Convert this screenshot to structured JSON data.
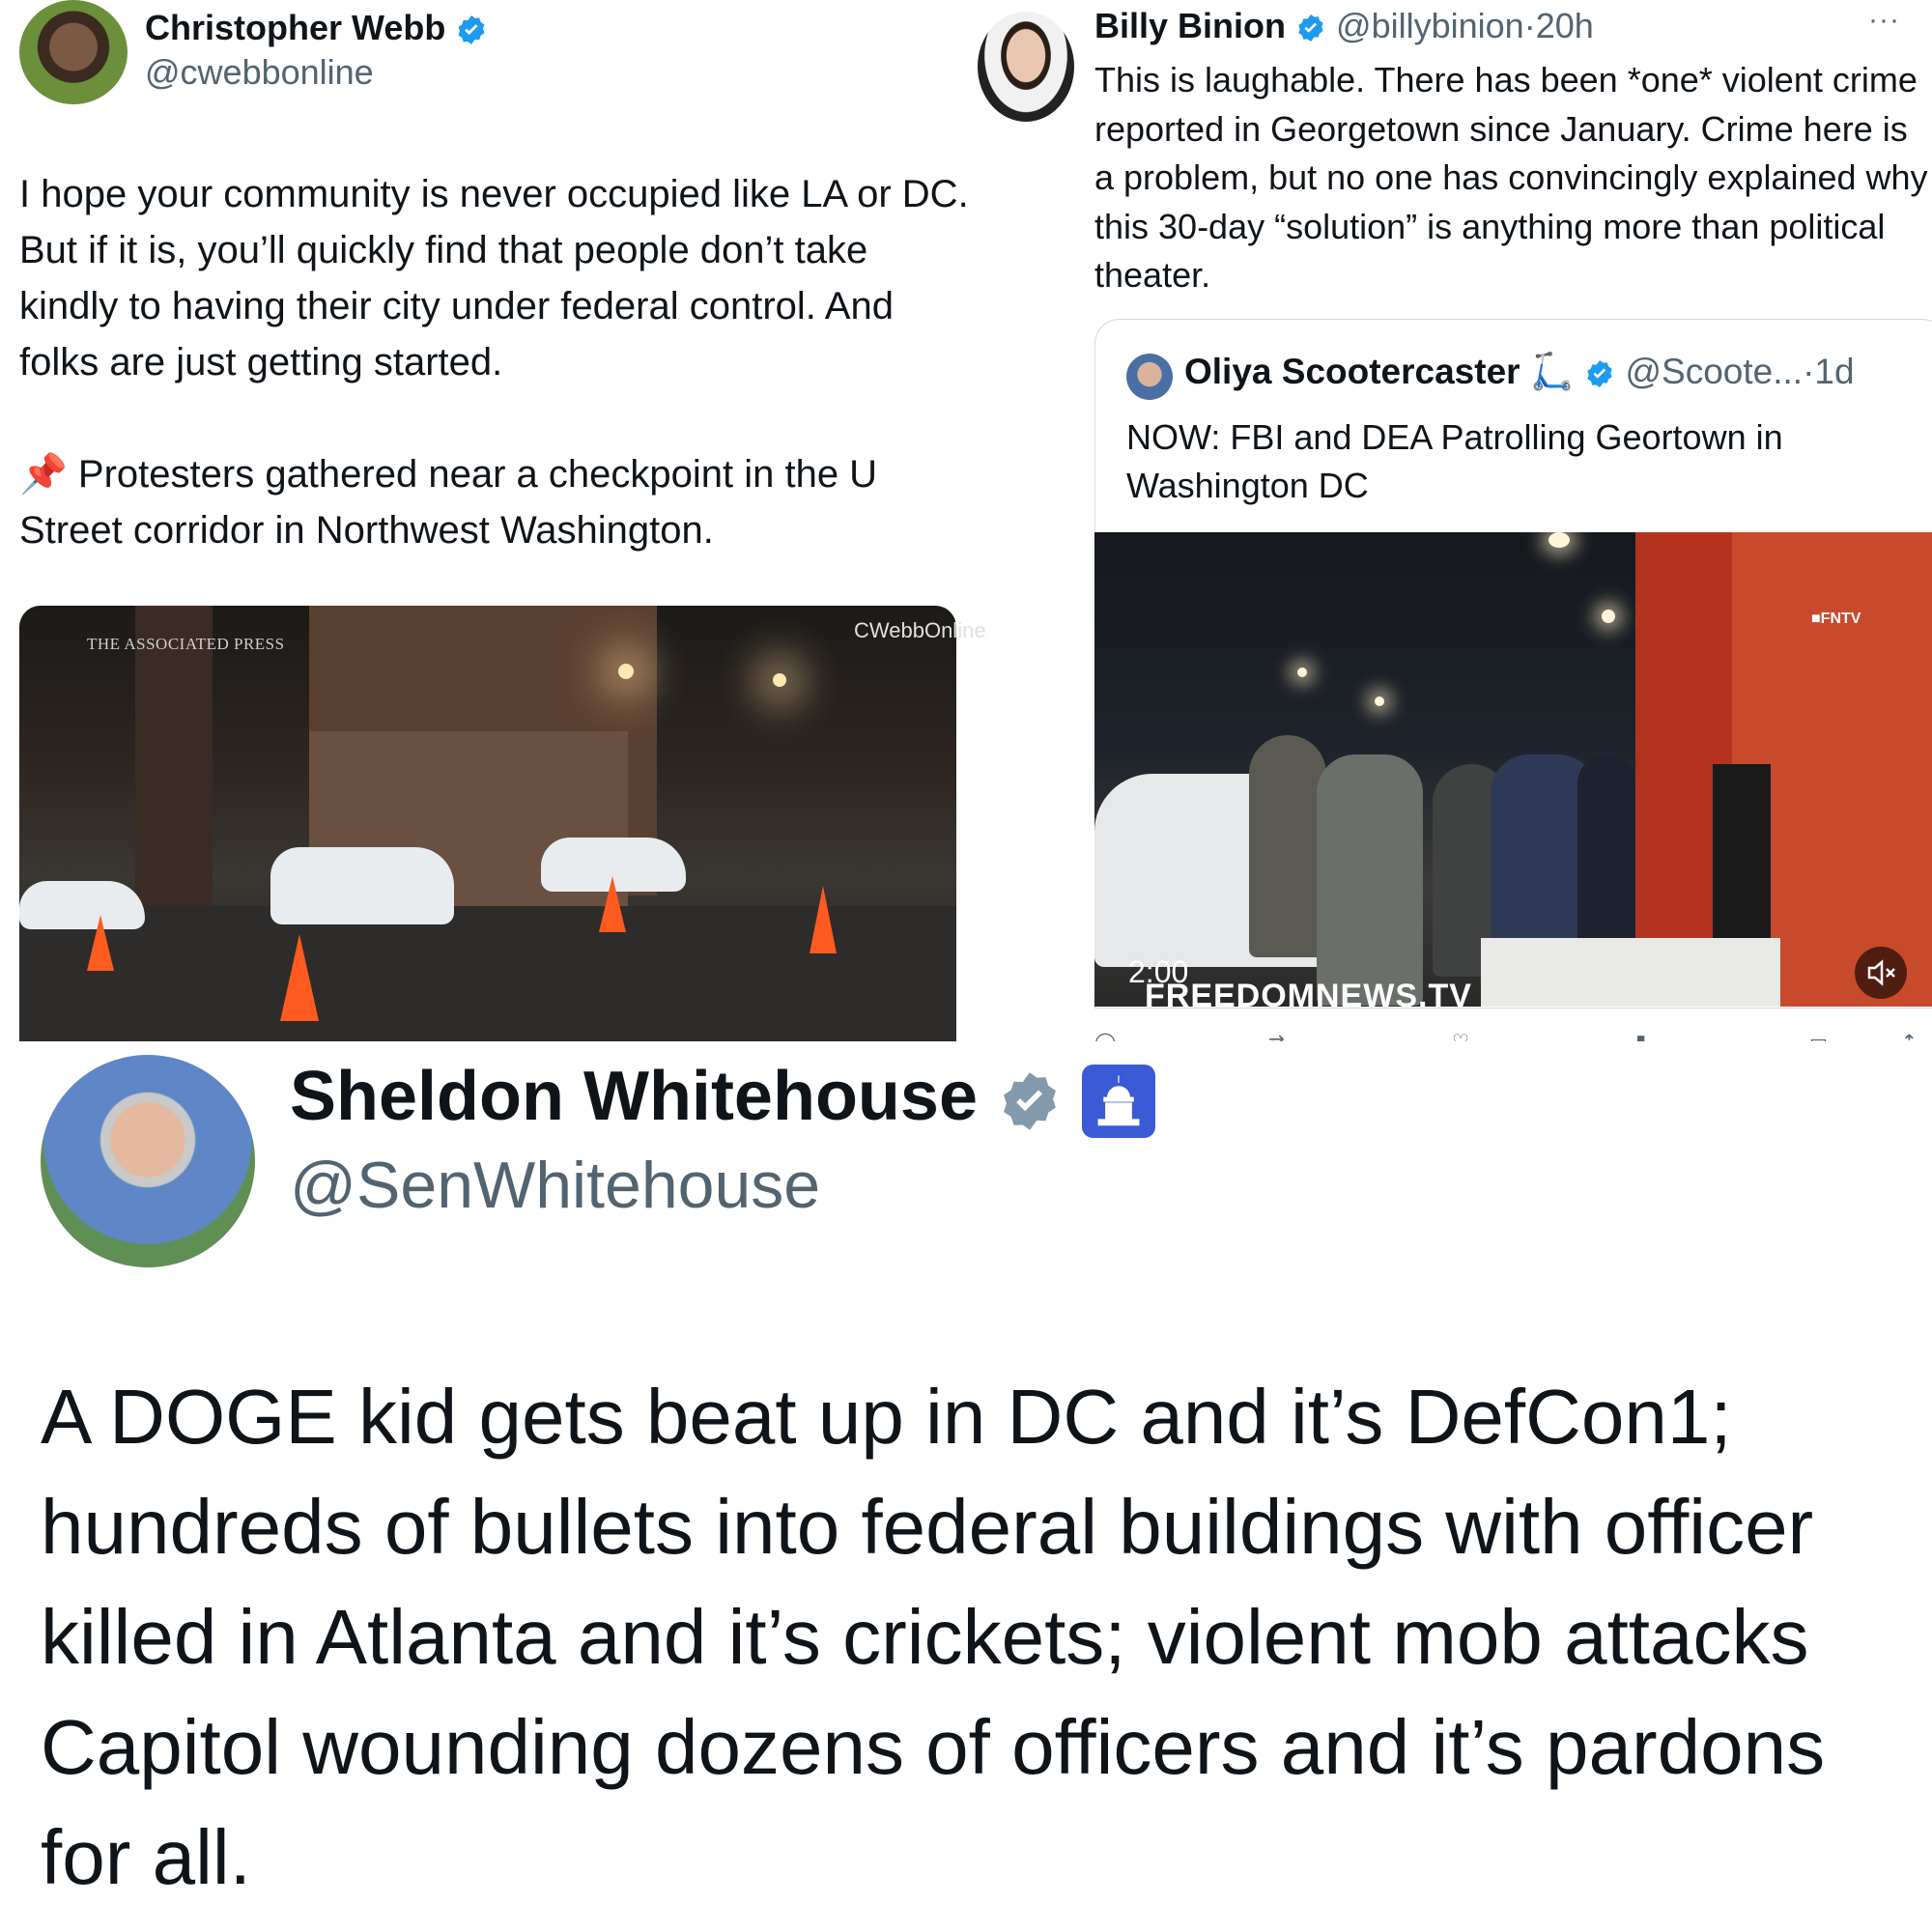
{
  "tweet1": {
    "name": "Christopher Webb",
    "handle": "@cwebbonline",
    "paragraph1": "I hope your community is never occupied like LA or DC. But if it is, you’ll quickly find that people don’t take kindly to having their city under federal control. And folks are just getting started.",
    "paragraph2": "📌 Protesters gathered near a checkpoint in the U Street corridor in Northwest Washington.",
    "media_watermark_left": "THE ASSOCIATED PRESS",
    "media_watermark_right": "CWebbOnline"
  },
  "tweet2": {
    "name": "Billy Binion",
    "handle": "@billybinion",
    "separator": "·",
    "time": "20h",
    "more": "···",
    "body": "This is laughable. There has been *one* violent crime reported in Georgetown since January. Crime here is a problem, but no one has convincingly explained why this 30-day “solution” is anything more than political theater.",
    "quote": {
      "name": "Oliya Scootercaster",
      "emoji": "🛴",
      "handle": "@Scoote...",
      "separator": "·",
      "time": "1d",
      "body": "NOW: FBI and DEA Patrolling Geortown in Washington DC",
      "video_time": "2:00",
      "video_brand": "FREEDOMNEWS.TV",
      "video_corner_logo": "■FNTV"
    }
  },
  "tweet3": {
    "name": "Sheldon Whitehouse",
    "handle": "@SenWhitehouse",
    "body": "A DOGE kid gets beat up in DC and it’s DefCon1; hundreds of bullets into federal buildings with officer killed in Atlanta and it’s crickets; violent mob attacks Capitol wounding dozens of officers and it’s pardons for all."
  },
  "colors": {
    "verified_blue": "#1d9bf0",
    "verified_gray": "#829aab",
    "text": "#0f1419",
    "muted": "#536471",
    "border": "#cfd9de"
  },
  "icons": {
    "verified": "verified-badge-icon",
    "capitol": "capitol-icon",
    "mute": "mute-icon",
    "more": "more-icon"
  }
}
